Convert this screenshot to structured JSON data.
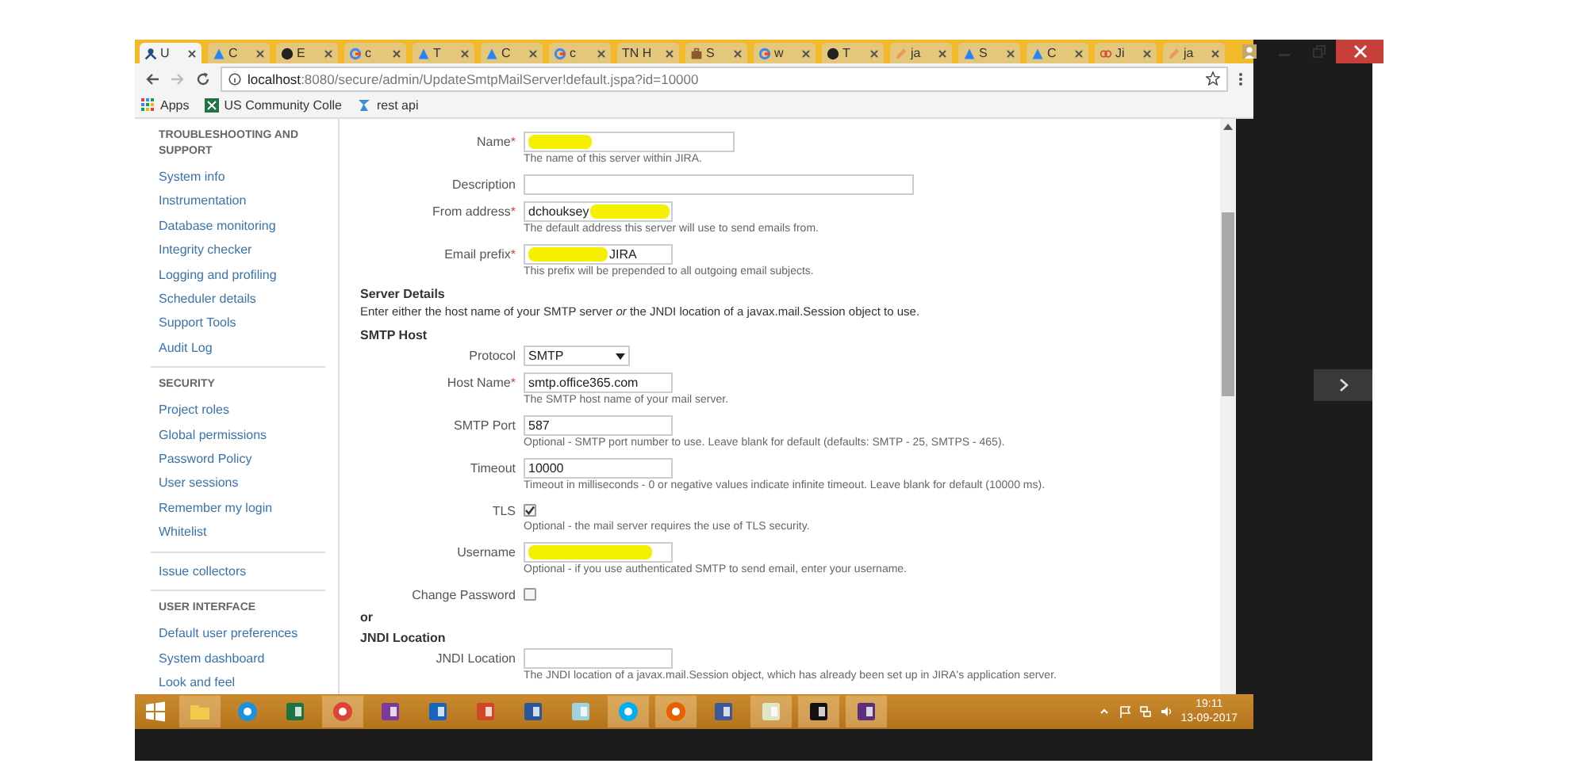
{
  "browser": {
    "tabs": [
      {
        "kind": "jira",
        "label": "U",
        "selected": true
      },
      {
        "kind": "atlassian",
        "label": "C",
        "selected": false
      },
      {
        "kind": "github",
        "label": "E",
        "selected": false
      },
      {
        "kind": "google",
        "label": "c",
        "selected": false
      },
      {
        "kind": "atlassian",
        "label": "T",
        "selected": false
      },
      {
        "kind": "atlassian",
        "label": "C",
        "selected": false
      },
      {
        "kind": "google",
        "label": "c",
        "selected": false
      },
      {
        "kind": "plain",
        "label": "TN H",
        "selected": false
      },
      {
        "kind": "briefcase",
        "label": "S",
        "selected": false
      },
      {
        "kind": "google",
        "label": "w",
        "selected": false
      },
      {
        "kind": "github",
        "label": "T",
        "selected": false
      },
      {
        "kind": "pencil",
        "label": "ja",
        "selected": false
      },
      {
        "kind": "atlassian",
        "label": "S",
        "selected": false
      },
      {
        "kind": "atlassian",
        "label": "C",
        "selected": false
      },
      {
        "kind": "loop",
        "label": "Ji",
        "selected": false
      },
      {
        "kind": "pencil",
        "label": "ja",
        "selected": false
      }
    ],
    "url_host": "localhost",
    "url_path": ":8080/secure/admin/UpdateSmtpMailServer!default.jspa?id=10000",
    "bookmarks": [
      {
        "kind": "apps",
        "label": "Apps"
      },
      {
        "kind": "sheet",
        "label": "US Community Colle"
      },
      {
        "kind": "bolt",
        "label": "rest api"
      }
    ]
  },
  "sidebar": {
    "sections": [
      {
        "heading": "TROUBLESHOOTING AND SUPPORT",
        "items": [
          "System info",
          "Instrumentation",
          "Database monitoring",
          "Integrity checker",
          "Logging and profiling",
          "Scheduler details",
          "Support Tools",
          "Audit Log"
        ]
      },
      {
        "heading": "SECURITY",
        "items": [
          "Project roles",
          "Global permissions",
          "Password Policy",
          "User sessions",
          "Remember my login",
          "Whitelist"
        ]
      },
      {
        "items": [
          "Issue collectors"
        ]
      },
      {
        "heading": "USER INTERFACE",
        "items": [
          "Default user preferences",
          "System dashboard",
          "Look and feel"
        ]
      }
    ]
  },
  "form": {
    "rows": [
      {
        "kind": "wide-text",
        "label": "Name",
        "mark": "*",
        "segments": [
          {
            "kind": "redaction"
          }
        ],
        "help": "The name of this server within JIRA."
      },
      {
        "kind": "full-text",
        "label": "Description"
      },
      {
        "kind": "text",
        "label": "From address",
        "mark": "*",
        "segments": [
          {
            "kind": "text",
            "text": "dchouksey"
          },
          {
            "kind": "redaction"
          }
        ],
        "help": "The default address this server will use to send emails from."
      },
      {
        "kind": "text",
        "label": "Email prefix",
        "mark": "*",
        "segments": [
          {
            "kind": "redaction"
          },
          {
            "kind": "text",
            "text": "JIRA"
          }
        ],
        "help": "This prefix will be prepended to all outgoing email subjects."
      },
      {
        "kind": "heading",
        "label": "Server Details"
      },
      {
        "kind": "paragraph",
        "text": "Enter either the host name of your SMTP server *or* the JNDI location of a javax.mail.Session object to use."
      },
      {
        "kind": "heading",
        "label": "SMTP Host"
      },
      {
        "kind": "select",
        "label": "Protocol",
        "value": "SMTP"
      },
      {
        "kind": "text",
        "label": "Host Name",
        "mark": "*",
        "segments": [
          {
            "kind": "text",
            "text": "smtp.office365.com"
          }
        ],
        "help": "The SMTP host name of your mail server."
      },
      {
        "kind": "text",
        "label": "SMTP Port",
        "segments": [
          {
            "kind": "text",
            "text": "587"
          }
        ],
        "help": "Optional - SMTP port number to use. Leave blank for default (defaults: SMTP - 25, SMTPS - 465)."
      },
      {
        "kind": "text",
        "label": "Timeout",
        "segments": [
          {
            "kind": "text",
            "text": "10000"
          }
        ],
        "help": "Timeout in milliseconds - 0 or negative values indicate infinite timeout. Leave blank for default (10000 ms)."
      },
      {
        "kind": "checkbox",
        "label": "TLS",
        "checked": true,
        "help": "Optional - the mail server requires the use of TLS security."
      },
      {
        "kind": "text",
        "label": "Username",
        "segments": [
          {
            "kind": "redaction"
          }
        ],
        "help": "Optional - if you use authenticated SMTP to send email, enter your username."
      },
      {
        "kind": "checkbox",
        "label": "Change Password",
        "checked": false
      },
      {
        "kind": "heading",
        "label": "or"
      },
      {
        "kind": "heading",
        "label": "JNDI Location"
      },
      {
        "kind": "text",
        "label": "JNDI Location",
        "help": "The JNDI location of a javax.mail.Session object, which has already been set up in JIRA's application server."
      }
    ]
  },
  "taskbar": {
    "apps": [
      {
        "kind": "explorer",
        "running": true
      },
      {
        "kind": "ie",
        "running": false
      },
      {
        "kind": "excel",
        "running": false
      },
      {
        "kind": "chrome",
        "running": true
      },
      {
        "kind": "onenote",
        "running": false
      },
      {
        "kind": "outlook",
        "running": false
      },
      {
        "kind": "powerpoint",
        "running": false
      },
      {
        "kind": "word",
        "running": false
      },
      {
        "kind": "notepad",
        "running": false
      },
      {
        "kind": "skype",
        "running": true
      },
      {
        "kind": "firefox",
        "running": true
      },
      {
        "kind": "facebook",
        "running": false
      },
      {
        "kind": "paint",
        "running": true
      },
      {
        "kind": "console",
        "running": true
      },
      {
        "kind": "game",
        "running": true
      }
    ],
    "time": "19:11",
    "date": "13-09-2017"
  }
}
